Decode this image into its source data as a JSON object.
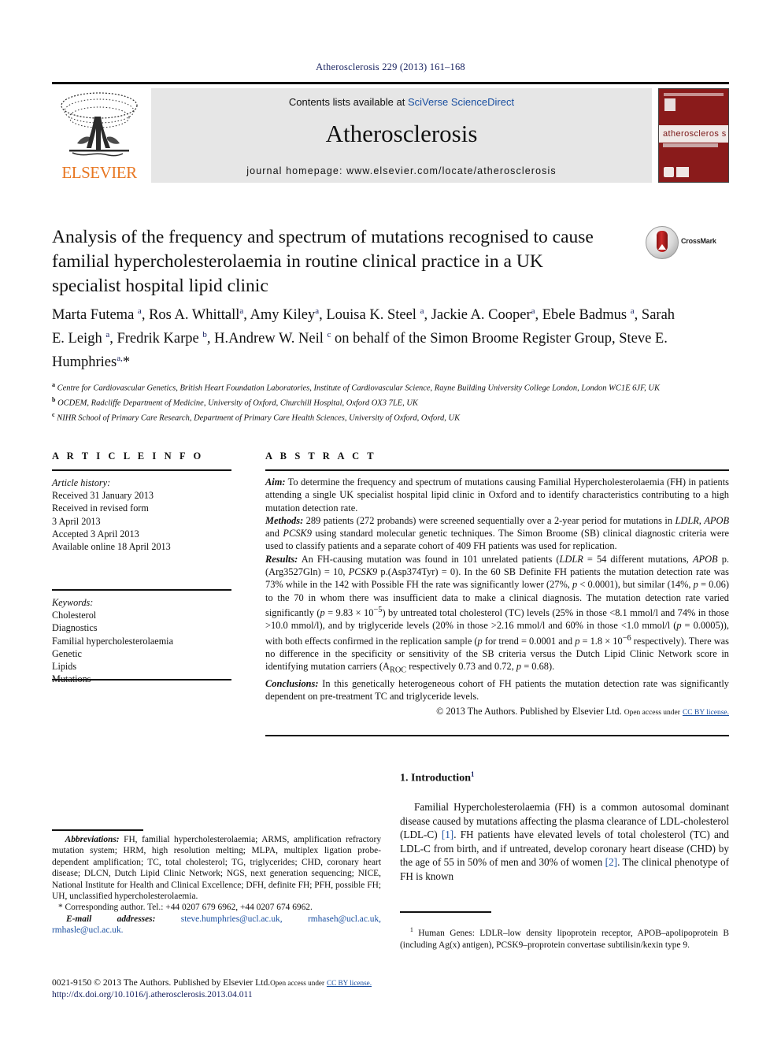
{
  "running_head": "Atherosclerosis 229 (2013) 161–168",
  "header": {
    "publisher_logo_text": "ELSEVIER",
    "contents_prefix": "Contents lists available at ",
    "contents_link": "SciVerse ScienceDirect",
    "journal_name": "Atherosclerosis",
    "homepage": "journal homepage: www.elsevier.com/locate/atherosclerosis",
    "cover_band_text": "atheroscleros s"
  },
  "article": {
    "title": "Analysis of the frequency and spectrum of mutations recognised to cause familial hypercholesterolaemia in routine clinical practice in a UK specialist hospital lipid clinic",
    "crossmark_label": "CrossMark",
    "authors_html": "Marta Futema <sup>a</sup>, Ros A. Whittall<sup>a</sup>, Amy Kiley<sup>a</sup>, Louisa K. Steel <sup>a</sup>, Jackie A. Cooper<sup>a</sup>, Ebele Badmus <sup>a</sup>, Sarah E. Leigh <sup>a</sup>, Fredrik Karpe <sup>b</sup>, H.Andrew W. Neil <sup>c</sup> on behalf of the Simon Broome Register Group, Steve E. Humphries<sup>a,</sup>*",
    "affiliations": [
      "a Centre for Cardiovascular Genetics, British Heart Foundation Laboratories, Institute of Cardiovascular Science, Rayne Building University College London, London WC1E 6JF, UK",
      "b OCDEM, Radcliffe Department of Medicine, University of Oxford, Churchill Hospital, Oxford OX3 7LE, UK",
      "c NIHR School of Primary Care Research, Department of Primary Care Health Sciences, University of Oxford, Oxford, UK"
    ]
  },
  "article_info": {
    "heading": "A R T I C L E   I N F O",
    "history_label": "Article history:",
    "history_lines": [
      "Received 31 January 2013",
      "Received in revised form",
      "3 April 2013",
      "Accepted 3 April 2013",
      "Available online 18 April 2013"
    ],
    "keywords_label": "Keywords:",
    "keywords": [
      "Cholesterol",
      "Diagnostics",
      "Familial hypercholesterolaemia",
      "Genetic",
      "Lipids",
      "Mutations"
    ]
  },
  "abstract": {
    "heading": "A B S T R A C T",
    "aim_label": "Aim:",
    "aim_text": " To determine the frequency and spectrum of mutations causing Familial Hypercholesterolaemia (FH) in patients attending a single UK specialist hospital lipid clinic in Oxford and to identify characteristics contributing to a high mutation detection rate.",
    "methods_label": "Methods:",
    "methods_html": " 289 patients (272 probands) were screened sequentially over a 2-year period for mutations in <i>LDLR</i>, <i>APOB</i> and <i>PCSK9</i> using standard molecular genetic techniques. The Simon Broome (SB) clinical diagnostic criteria were used to classify patients and a separate cohort of 409 FH patients was used for replication.",
    "results_label": "Results:",
    "results_html": " An FH-causing mutation was found in 101 unrelated patients (<i>LDLR</i> = 54 different mutations, <i>APOB</i> p.(Arg3527Gln) = 10, <i>PCSK9</i> p.(Asp374Tyr) = 0). In the 60 SB Definite FH patients the mutation detection rate was 73% while in the 142 with Possible FH the rate was significantly lower (27%, <i>p</i> &lt; 0.0001), but similar (14%, <i>p</i> = 0.06) to the 70 in whom there was insufficient data to make a clinical diagnosis. The mutation detection rate varied significantly (<i>p</i> = 9.83 × 10<sup>−5</sup>) by untreated total cholesterol (TC) levels (25% in those &lt;8.1 mmol/l and 74% in those &gt;10.0 mmol/l), and by triglyceride levels (20% in those &gt;2.16 mmol/l and 60% in those &lt;1.0 mmol/l (<i>p</i> = 0.0005)), with both effects confirmed in the replication sample (<i>p</i> for trend = 0.0001 and <i>p</i> = 1.8 × 10<sup>−6</sup> respectively). There was no difference in the specificity or sensitivity of the SB criteria versus the Dutch Lipid Clinic Network score in identifying mutation carriers (A<sub>ROC</sub> respectively 0.73 and 0.72, <i>p</i> = 0.68).",
    "conclusions_label": "Conclusions:",
    "conclusions_text": " In this genetically heterogeneous cohort of FH patients the mutation detection rate was significantly dependent on pre-treatment TC and triglyceride levels.",
    "copyright": "© 2013 The Authors. Published by Elsevier Ltd.",
    "open_access": "Open access under",
    "license": "CC BY license."
  },
  "introduction": {
    "heading": "1. Introduction",
    "heading_sup": "1",
    "paragraph_html": "Familial Hypercholesterolaemia (FH) is a common autosomal dominant disease caused by mutations affecting the plasma clearance of LDL-cholesterol (LDL-C) <span class=\"ref\">[1]</span>. FH patients have elevated levels of total cholesterol (TC) and LDL-C from birth, and if untreated, develop coronary heart disease (CHD) by the age of 55 in 50% of men and 30% of women <span class=\"ref\">[2]</span>. The clinical phenotype of FH is known"
  },
  "footnotes": {
    "abbrev_label": "Abbreviations:",
    "abbrev_text": " FH, familial hypercholesterolaemia; ARMS, amplification refractory mutation system; HRM, high resolution melting; MLPA, multiplex ligation probe-dependent amplification; TC, total cholesterol; TG, triglycerides; CHD, coronary heart disease; DLCN, Dutch Lipid Clinic Network; NGS, next generation sequencing; NICE, National Institute for Health and Clinical Excellence; DFH, definite FH; PFH, possible FH; UH, unclassified hypercholesterolaemia.",
    "corresponding": "* Corresponding author. Tel.: +44 0207 679 6962, +44 0207 674 6962.",
    "email_label": "E-mail addresses:",
    "emails": "steve.humphries@ucl.ac.uk, rmhaseh@ucl.ac.uk, rmhasle@ucl.ac.uk.",
    "genes_note_sup": "1",
    "genes_note": " Human Genes: LDLR–low density lipoprotein receptor, APOB–apolipoprotein B (including Ag(x) antigen), PCSK9–proprotein convertase subtilisin/kexin type 9."
  },
  "bottom": {
    "issn_copy": "0021-9150 © 2013 The Authors. Published by Elsevier Ltd.",
    "open_access": "Open access under",
    "license": "CC BY license.",
    "doi": "http://dx.doi.org/10.1016/j.atherosclerosis.2013.04.011"
  },
  "colors": {
    "link_blue": "#1a4fa0",
    "navy": "#16205e",
    "elsevier_orange": "#E87722",
    "cover_red": "#8a1b1b",
    "band_gray": "#e6e6e6"
  }
}
